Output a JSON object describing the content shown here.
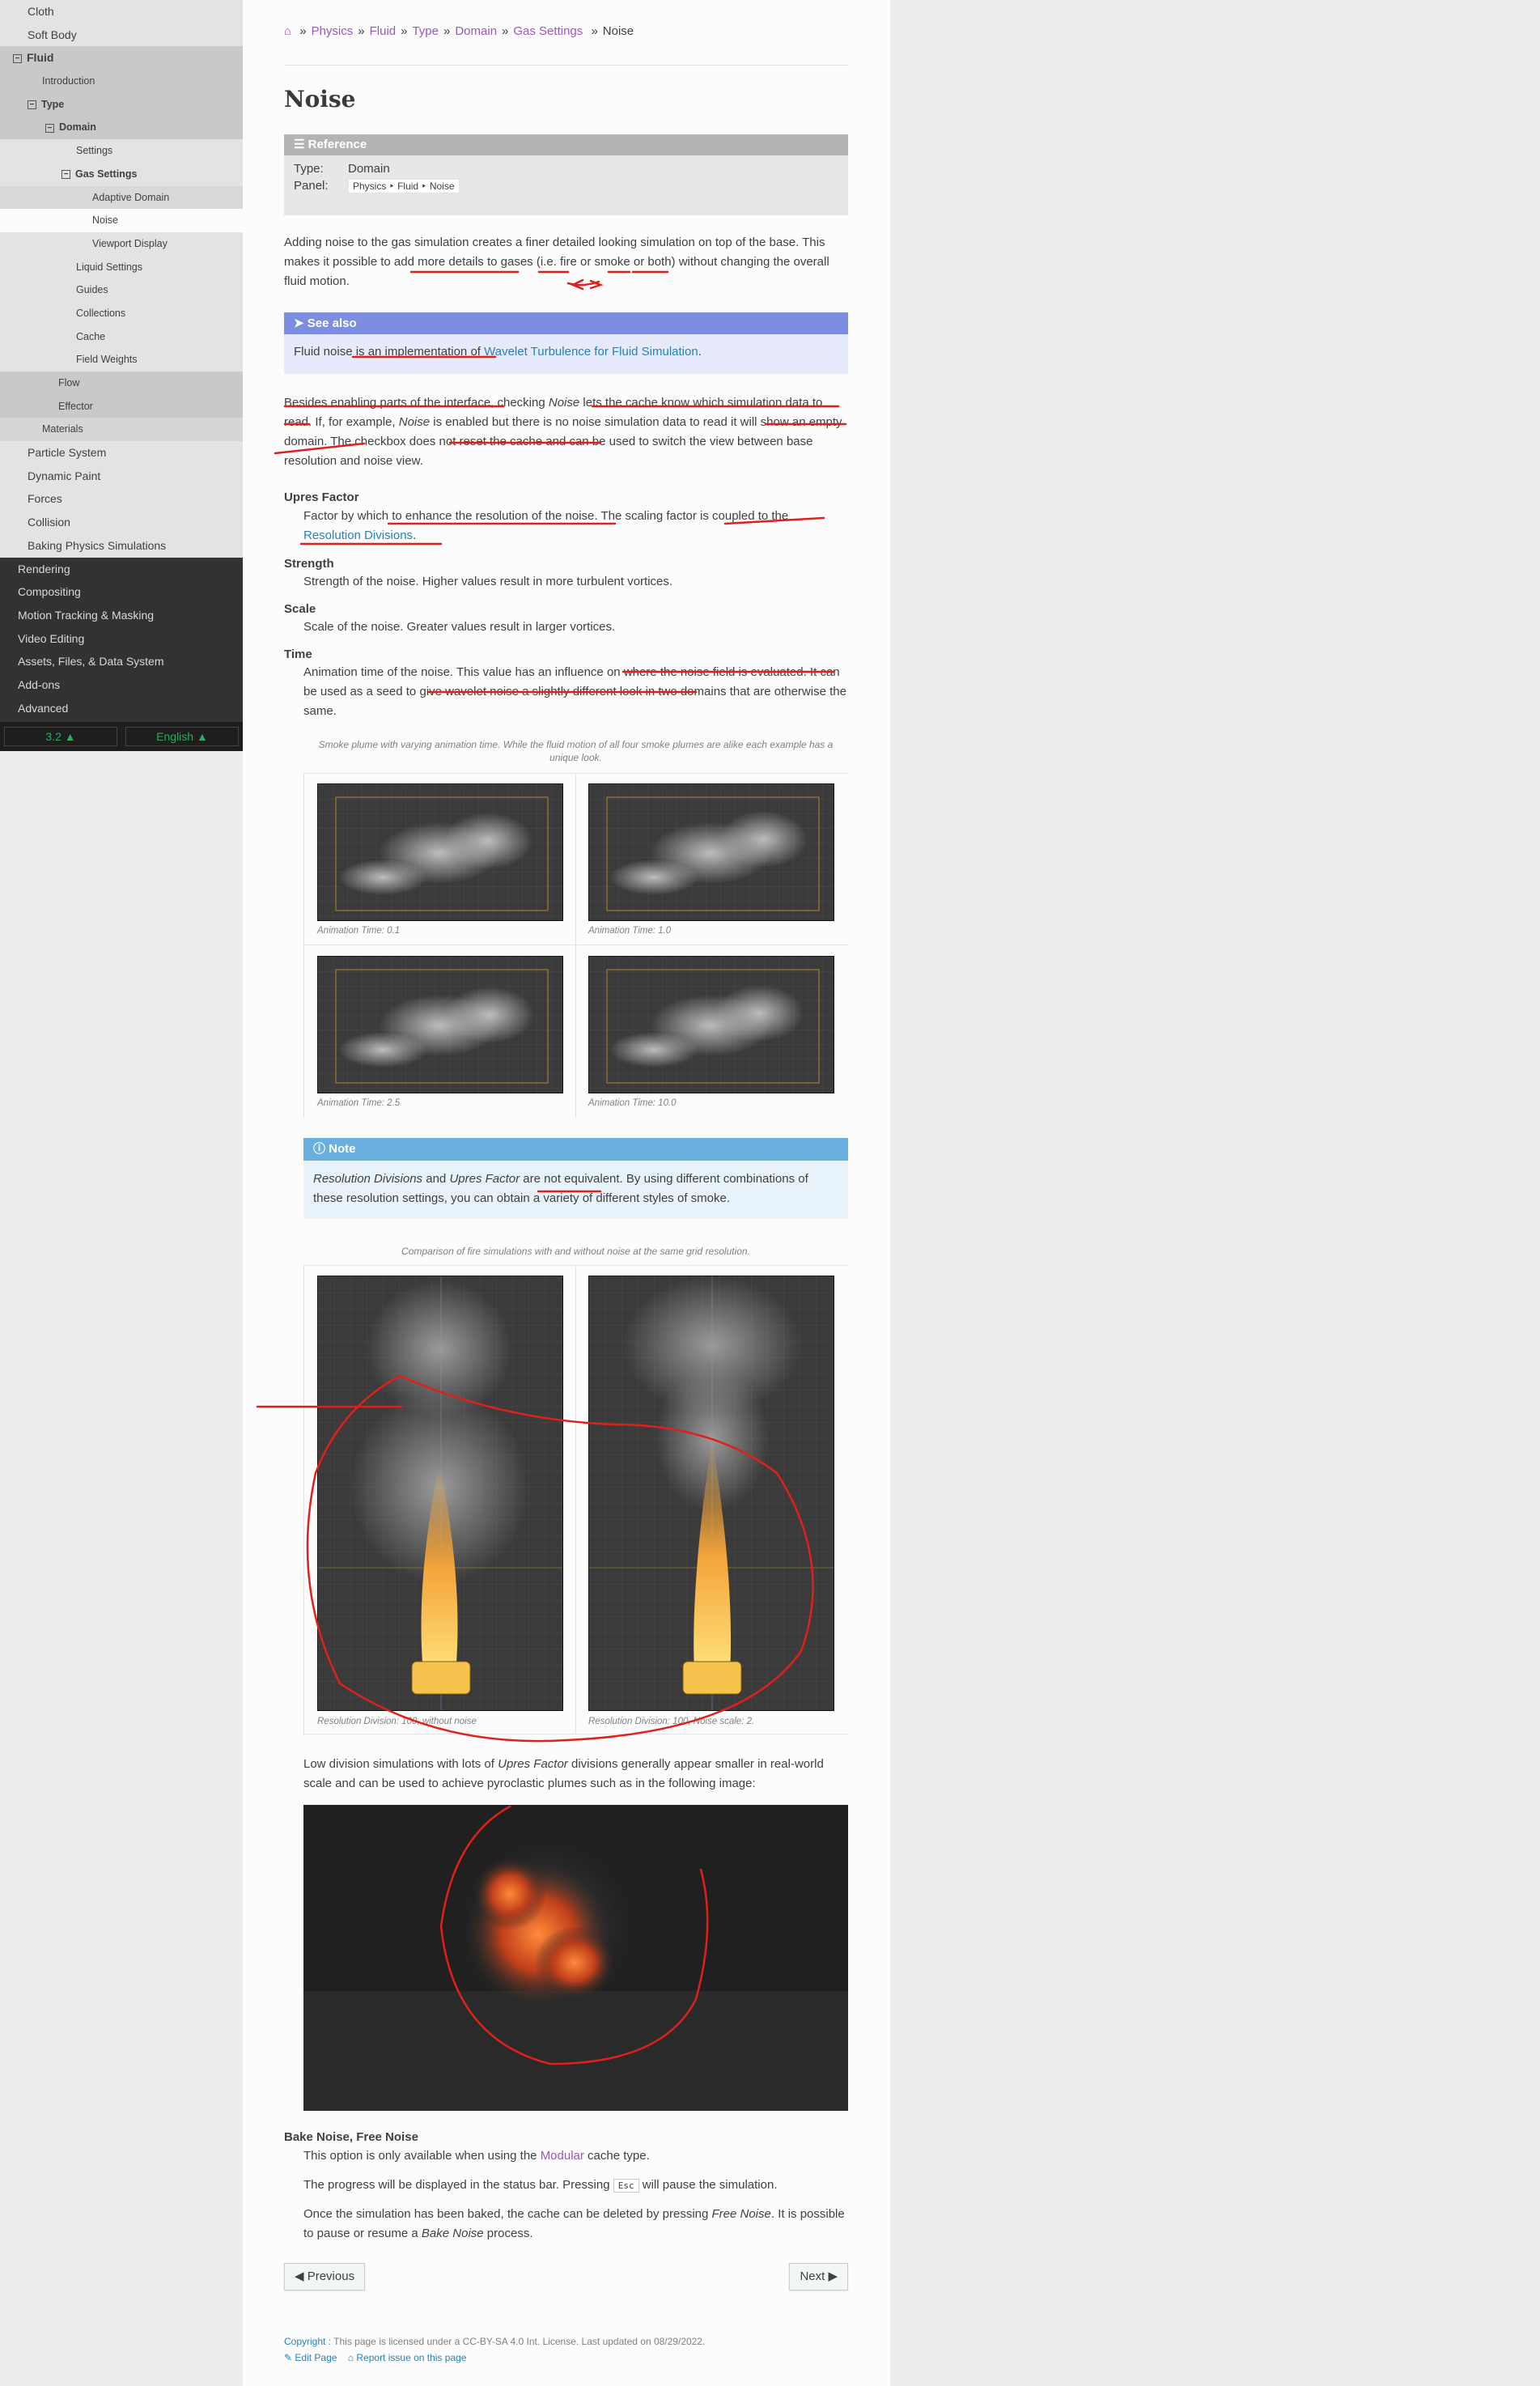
{
  "sidebar": {
    "light_items": [
      {
        "label": "Cloth",
        "level": "l1"
      },
      {
        "label": "Soft Body",
        "level": "l1"
      },
      {
        "label": "Fluid",
        "level": "l1-cur",
        "toggle": "⊟"
      },
      {
        "label": "Introduction",
        "level": "l2"
      },
      {
        "label": "Type",
        "level": "l2-cur",
        "toggle": "⊟"
      },
      {
        "label": "Domain",
        "level": "l3-cur",
        "toggle": "⊟"
      },
      {
        "label": "Settings",
        "level": "l4"
      },
      {
        "label": "Gas Settings",
        "level": "l4-cur",
        "toggle": "⊟"
      },
      {
        "label": "Adaptive Domain",
        "level": "l5"
      },
      {
        "label": "Noise",
        "level": "l5-current"
      },
      {
        "label": "Viewport Display",
        "level": "l5"
      },
      {
        "label": "Liquid Settings",
        "level": "l4"
      },
      {
        "label": "Guides",
        "level": "l4"
      },
      {
        "label": "Collections",
        "level": "l4"
      },
      {
        "label": "Cache",
        "level": "l4"
      },
      {
        "label": "Field Weights",
        "level": "l4"
      },
      {
        "label": "Flow",
        "level": "l3"
      },
      {
        "label": "Effector",
        "level": "l3"
      },
      {
        "label": "Materials",
        "level": "l2"
      },
      {
        "label": "Particle System",
        "level": "l1"
      },
      {
        "label": "Dynamic Paint",
        "level": "l1"
      },
      {
        "label": "Forces",
        "level": "l1"
      },
      {
        "label": "Collision",
        "level": "l1"
      },
      {
        "label": "Baking Physics Simulations",
        "level": "l1"
      }
    ],
    "dark_items": [
      "Rendering",
      "Compositing",
      "Motion Tracking & Masking",
      "Video Editing",
      "Assets, Files, & Data System",
      "Add-ons",
      "Advanced"
    ],
    "version": "3.2 ▲",
    "language": "English ▲"
  },
  "breadcrumbs": [
    "Physics",
    "Fluid",
    "Type",
    "Domain",
    "Gas Settings"
  ],
  "breadcrumb_current": "Noise",
  "breadcrumb_sep": "»",
  "home_icon": "home-icon",
  "title": "Noise",
  "reference": {
    "header": "Reference",
    "type_key": "Type:",
    "type_val": "Domain",
    "panel_key": "Panel:",
    "panel_val": "Physics ‣ Fluid ‣ Noise"
  },
  "intro_text": "Adding noise to the gas simulation creates a finer detailed looking simulation on top of the base. This makes it possible to add more details to gases (i.e. fire or smoke or both) without changing the overall fluid motion.",
  "see_also": {
    "header": "See also",
    "before": "Fluid noise is an implementation of ",
    "link": "Wavelet Turbulence for Fluid Simulation",
    "after": "."
  },
  "enable_text": {
    "p1": "Besides enabling parts of the interface, checking ",
    "em1": "Noise",
    "p2": " lets the cache know which simulation data to read. If, for example, ",
    "em2": "Noise",
    "p3": " is enabled but there is no noise simulation data to read it will show an empty domain. The checkbox does not reset the cache and can be used to switch the view between base resolution and noise view."
  },
  "props": {
    "upres_title": "Upres Factor",
    "upres_text": "Factor by which to enhance the resolution of the noise. The scaling factor is coupled to the ",
    "upres_link": "Resolution Divisions",
    "upres_end": ".",
    "strength_title": "Strength",
    "strength_text": "Strength of the noise. Higher values result in more turbulent vortices.",
    "scale_title": "Scale",
    "scale_text": "Scale of the noise. Greater values result in larger vortices.",
    "time_title": "Time",
    "time_text": "Animation time of the noise. This value has an influence on where the noise field is evaluated. It can be used as a seed to give wavelet noise a slightly different look in two domains that are otherwise the same."
  },
  "fig1": {
    "caption": "Smoke plume with varying animation time. While the fluid motion of all four smoke plumes are alike each example has a unique look.",
    "captions": [
      "Animation Time: 0.1",
      "Animation Time: 1.0",
      "Animation Time: 2.5",
      "Animation Time: 10.0"
    ]
  },
  "note": {
    "header": "Note",
    "em1": "Resolution Divisions",
    "and": " and ",
    "em2": "Upres Factor",
    "rest": " are not equivalent. By using different combinations of these resolution settings, you can obtain a variety of different styles of smoke."
  },
  "fig2": {
    "caption": "Comparison of fire simulations with and without noise at the same grid resolution.",
    "captions": [
      "Resolution Division: 100, without noise",
      "Resolution Division: 100, Noise scale: 2."
    ]
  },
  "low_div": {
    "p1": "Low division simulations with lots of ",
    "em": "Upres Factor",
    "p2": " divisions generally appear smaller in real-world scale and can be used to achieve pyroclastic plumes such as in the following image:"
  },
  "bake": {
    "title": "Bake Noise, Free Noise",
    "t1a": "This option is only available when using the ",
    "t1link": "Modular",
    "t1b": " cache type.",
    "t2a": "The progress will be displayed in the status bar. Pressing ",
    "t2kbd": "Esc",
    "t2b": " will pause the simulation.",
    "t3a": "Once the simulation has been baked, the cache can be deleted by pressing ",
    "t3em": "Free Noise",
    "t3b": ". It is possible to pause or resume a ",
    "t3em2": "Bake Noise",
    "t3c": " process."
  },
  "nav": {
    "previous": "Previous",
    "next": "Next"
  },
  "footer": {
    "copyright_link": "Copyright",
    "copyright_text": ": This page is licensed under a CC-BY-SA 4.0 Int. License. Last updated on 08/29/2022.",
    "edit": "Edit Page",
    "report": "Report issue on this page"
  },
  "colors": {
    "link": "#2980b9",
    "visited": "#9b59b6",
    "annotation": "#e0201b",
    "sidebar_dark": "#343131"
  }
}
